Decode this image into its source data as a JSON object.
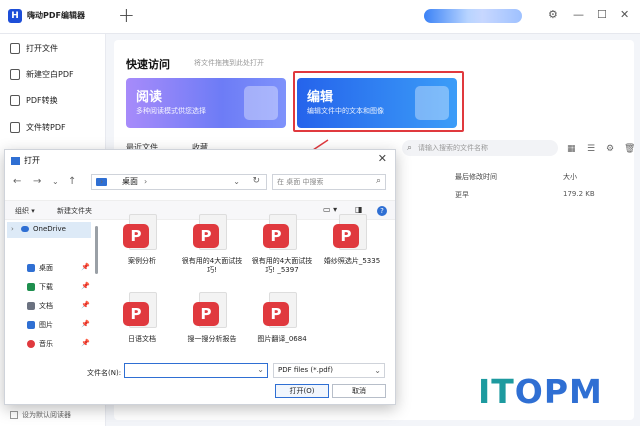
{
  "app": {
    "name": "嗨动PDF编辑器",
    "logo_glyph": "H"
  },
  "sidebar": {
    "items": [
      {
        "label": "打开文件"
      },
      {
        "label": "新建空白PDF"
      },
      {
        "label": "PDF转换"
      },
      {
        "label": "文件转PDF"
      }
    ],
    "default_reader_label": "设为默认阅读器"
  },
  "quick_access": {
    "title": "快速访问",
    "subtitle": "将文件拖拽到此处打开",
    "cards": [
      {
        "title": "阅读",
        "desc": "多种阅读模式供您选择"
      },
      {
        "title": "编辑",
        "desc": "编辑文件中的文本和图像"
      }
    ]
  },
  "recent": {
    "tabs": [
      "最近文件",
      "收藏"
    ],
    "search_placeholder": "请输入搜索的文件名称",
    "columns": {
      "modified": "最后修改时间",
      "size": "大小"
    },
    "row": {
      "modified": "更早",
      "size": "179.2 KB"
    }
  },
  "dialog": {
    "title": "打开",
    "breadcrumb": "桌面",
    "search_placeholder": "在 桌面 中搜索",
    "toolbar": {
      "organize": "组织",
      "new_folder": "新建文件夹"
    },
    "nav": [
      {
        "label": "OneDrive",
        "color": "#2f6fd3"
      },
      {
        "label": "桌面",
        "color": "#2f6fd3"
      },
      {
        "label": "下载",
        "color": "#1e8f4e"
      },
      {
        "label": "文档",
        "color": "#6b7280"
      },
      {
        "label": "图片",
        "color": "#2f6fd3"
      },
      {
        "label": "音乐",
        "color": "#e0393e"
      }
    ],
    "files": [
      {
        "name": "案例分析"
      },
      {
        "name": "很有用的4大面试技巧!"
      },
      {
        "name": "很有用的4大面试技巧! _5397"
      },
      {
        "name": "婚纱照选片_5335"
      },
      {
        "name": "日语文档"
      },
      {
        "name": "搜一搜分析报告"
      },
      {
        "name": "图片翻译_0684"
      }
    ],
    "filename_label": "文件名(N):",
    "filename_value": "",
    "filetype": "PDF files (*.pdf)",
    "open_button": "打开(O)",
    "cancel_button": "取消"
  },
  "watermark": {
    "part1": "IT",
    "part2": "OPM"
  },
  "colors": {
    "accent": "#2f6fd3",
    "highlight": "#e0393e",
    "pdf_red": "#e0393e"
  }
}
